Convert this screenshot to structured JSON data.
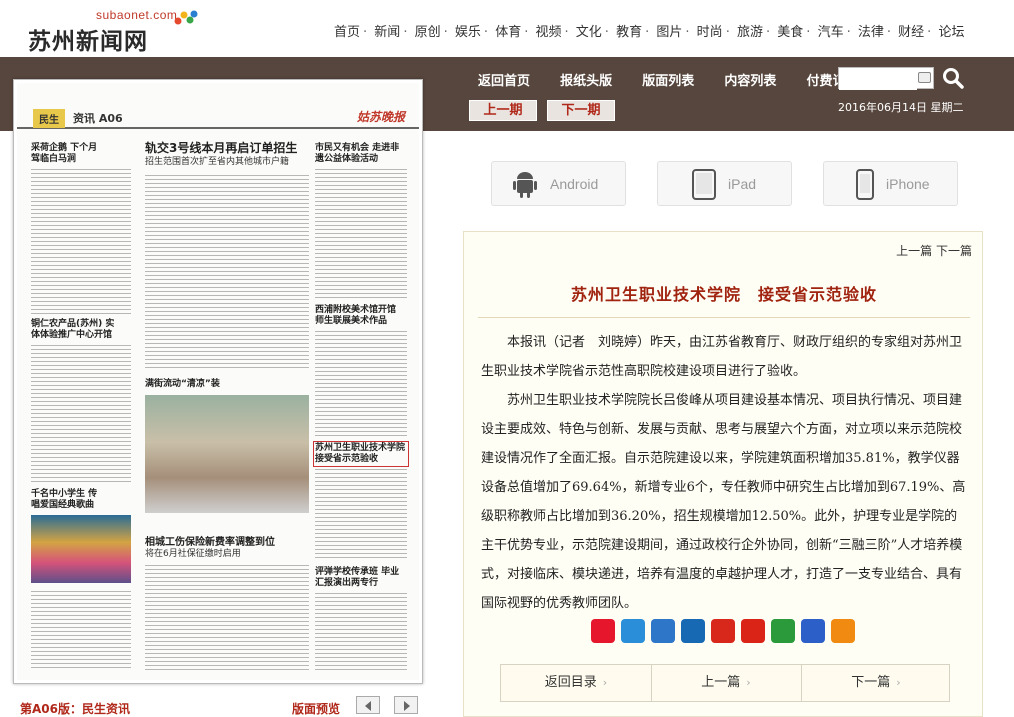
{
  "logo": {
    "sub": "subaonet.com",
    "main": "苏州新闻网"
  },
  "nav": [
    "首页",
    "新闻",
    "原创",
    "娱乐",
    "体育",
    "视频",
    "文化",
    "教育",
    "图片",
    "时尚",
    "旅游",
    "美食",
    "汽车",
    "法律",
    "财经",
    "论坛"
  ],
  "band": {
    "links": [
      "返回首页",
      "报纸头版",
      "版面列表",
      "内容列表",
      "付费订阅"
    ],
    "prev_issue": "上一期",
    "next_issue": "下一期",
    "date": "2016年06月14日  星期二"
  },
  "apps": [
    "Android",
    "iPad",
    "iPhone"
  ],
  "newspaper": {
    "tag": "民生",
    "section": "资讯 A06",
    "brand": "姑苏晚报",
    "headlines": {
      "h1": "采荷企鹅 下个月驾临白马涧",
      "h2": "轨交3号线本月再启订单招生",
      "h2sub": "招生范围首次扩至省内其他城市户籍",
      "h3": "市民又有机会 走进非遗公益体验活动",
      "h4": "西浦附校美术馆开馆 师生联展美术作品",
      "h5": "铜仁农产品(苏州) 实体体验推广中心开馆",
      "h6": "满街流动“清凉”装",
      "h7": "苏州卫生职业技术学院 接受省示范验收",
      "h8": "千名中小学生 传唱爱国经典歌曲",
      "h9": "相城工伤保险新费率调整到位",
      "h9sub": "将在6月社保征缴时启用",
      "h10": "评弹学校传承班 毕业汇报演出两专行"
    },
    "page_label": "第A06版：民生资讯",
    "preview_label": "版面预览"
  },
  "article": {
    "nav_prev": "上一篇",
    "nav_next": "下一篇",
    "title": "苏州卫生职业技术学院　接受省示范验收",
    "paragraphs": [
      "本报讯（记者　刘晓婷）昨天，由江苏省教育厅、财政厅组织的专家组对苏州卫生职业技术学院省示范性高职院校建设项目进行了验收。",
      "苏州卫生职业技术学院院长吕俊峰从项目建设基本情况、项目执行情况、项目建设主要成效、特色与创新、发展与贡献、思考与展望六个方面，对立项以来示范院校建设情况作了全面汇报。自示范院建设以来，学院建筑面积增加35.81%，教学仪器设备总值增加了69.64%，新增专业6个，专任教师中研究生占比增加到67.19%、高级职称教师占比增加到36.20%，招生规模增加12.50%。此外，护理专业是学院的主干优势专业，示范院建设期间，通过政校行企外协同，创新“三融三阶”人才培养模式，对接临床、模块递进，培养有温度的卓越护理人才，打造了一支专业结合、具有国际视野的优秀教师团队。"
    ],
    "share_icons": [
      "weibo-icon",
      "qzone-icon",
      "favorite-icon",
      "renren-icon",
      "renren-red-icon",
      "qq-icon",
      "douban-icon",
      "baidu-icon",
      "more-icon"
    ],
    "share_colors": [
      "#e6162d",
      "#2a8fd8",
      "#2e76c8",
      "#1769b4",
      "#d8281c",
      "#d92417",
      "#2a9a3b",
      "#2d5fc9",
      "#f08a10"
    ],
    "bottom": {
      "back": "返回目录",
      "prev": "上一篇",
      "next": "下一篇"
    }
  }
}
